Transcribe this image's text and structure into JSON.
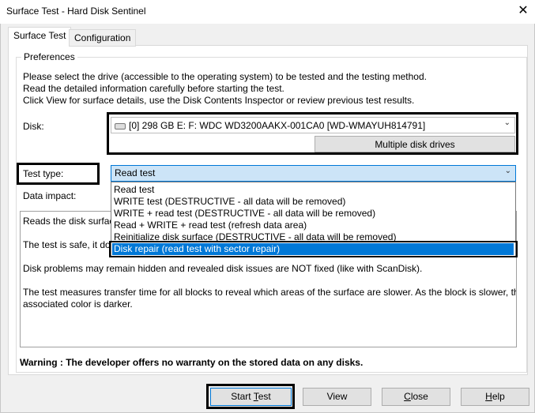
{
  "window": {
    "title": "Surface Test - Hard Disk Sentinel",
    "close_glyph": "✕"
  },
  "tabs": [
    {
      "label": "Surface Test",
      "active": true
    },
    {
      "label": "Configuration",
      "active": false
    }
  ],
  "preferences": {
    "title": "Preferences",
    "intro": [
      "Please select the drive (accessible to the operating system) to be tested and the testing method.",
      "Read the detailed information carefully before starting the test.",
      "Click View for surface details, use the Disk Contents Inspector or review previous test results."
    ]
  },
  "disk": {
    "label": "Disk:",
    "value": "[0]   298 GB    E: F:      WDC WD3200AAKX-001CA0 [WD-WMAYUH814791]",
    "multiple_button": "Multiple disk drives"
  },
  "test_type": {
    "label": "Test type:",
    "value": "Read test",
    "options": [
      "Read test",
      "WRITE test (DESTRUCTIVE - all data will be removed)",
      "WRITE + read test (DESTRUCTIVE - all data will be removed)",
      "Read + WRITE + read test (refresh data area)",
      "Reinitialize disk surface (DESTRUCTIVE - all data will be removed)",
      "Disk repair (read test with sector repair)"
    ],
    "selected_index": 5
  },
  "data_impact": {
    "label": "Data impact:"
  },
  "description": {
    "lines": [
      "Reads the disk surface",
      "The test is safe, it do",
      "Disk problems may remain hidden and revealed disk issues are NOT fixed (like with ScanDisk).",
      "The test measures transfer time for all blocks to reveal which areas of the surface are slower. As the block is slower, the",
      "associated color is darker."
    ]
  },
  "warning": "Warning : The developer offers no warranty on the stored data on any disks.",
  "buttons": {
    "start_prefix": "Start ",
    "start_mnemonic": "T",
    "start_suffix": "est",
    "view": "View",
    "close_mnemonic": "C",
    "close_suffix": "lose",
    "help_mnemonic": "H",
    "help_suffix": "elp"
  },
  "colors": {
    "selection": "#0078d7",
    "highlight_border": "#000000"
  }
}
